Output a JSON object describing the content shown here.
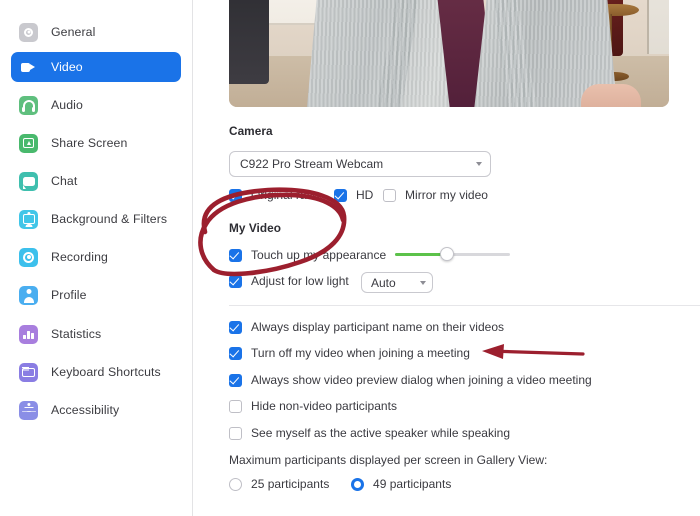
{
  "sidebar": {
    "items": [
      {
        "label": "General",
        "icon": "gear-icon",
        "color": "#c9c9ce",
        "active": false
      },
      {
        "label": "Video",
        "icon": "video-camera-icon",
        "color": "#1a73e8",
        "active": true
      },
      {
        "label": "Audio",
        "icon": "headphones-icon",
        "color": "#5fbf7e",
        "active": false
      },
      {
        "label": "Share Screen",
        "icon": "share-screen-icon",
        "color": "#49b96d",
        "active": false
      },
      {
        "label": "Chat",
        "icon": "chat-bubble-icon",
        "color": "#3fbfae",
        "active": false
      },
      {
        "label": "Background & Filters",
        "icon": "person-frame-icon",
        "color": "#41c6e8",
        "active": false
      },
      {
        "label": "Recording",
        "icon": "record-circle-icon",
        "color": "#3cc0ec",
        "active": false
      },
      {
        "label": "Profile",
        "icon": "person-icon",
        "color": "#4aaef0",
        "active": false
      },
      {
        "label": "Statistics",
        "icon": "bar-chart-icon",
        "color": "#a87ede",
        "active": false
      },
      {
        "label": "Keyboard Shortcuts",
        "icon": "keyboard-icon",
        "color": "#8a7de3",
        "active": false
      },
      {
        "label": "Accessibility",
        "icon": "accessibility-icon",
        "color": "#8a8ee6",
        "active": false
      }
    ]
  },
  "video_preview": {
    "alt": "self-view video preview"
  },
  "camera": {
    "heading": "Camera",
    "device": "C922 Pro Stream Webcam",
    "options": [
      {
        "label": "Original ratio",
        "checked": true
      },
      {
        "label": "HD",
        "checked": true
      },
      {
        "label": "Mirror my video",
        "checked": false
      }
    ]
  },
  "my_video": {
    "heading": "My Video",
    "touch_up": {
      "label": "Touch up my appearance",
      "checked": true,
      "slider_percent": 45
    },
    "low_light": {
      "label": "Adjust for low light",
      "checked": true,
      "mode": "Auto"
    }
  },
  "meeting_options": [
    {
      "label": "Always display participant name on their videos",
      "checked": true
    },
    {
      "label": "Turn off my video when joining a meeting",
      "checked": true
    },
    {
      "label": "Always show video preview dialog when joining a video meeting",
      "checked": true
    },
    {
      "label": "Hide non-video participants",
      "checked": false
    },
    {
      "label": "See myself as the active speaker while speaking",
      "checked": false
    }
  ],
  "gallery": {
    "label": "Maximum participants displayed per screen in Gallery View:",
    "choices": [
      {
        "label": "25 participants",
        "selected": false
      },
      {
        "label": "49 participants",
        "selected": true
      }
    ]
  },
  "annotations": {
    "ellipse": {
      "name": "red-ellipse-highlight",
      "color": "#9c1f2e"
    },
    "arrow": {
      "name": "red-arrow-pointer",
      "color": "#9c1f2e"
    }
  },
  "colors": {
    "accent": "#1a73e8",
    "slider_fill": "#5cc24a",
    "annotation": "#9c1f2e"
  }
}
